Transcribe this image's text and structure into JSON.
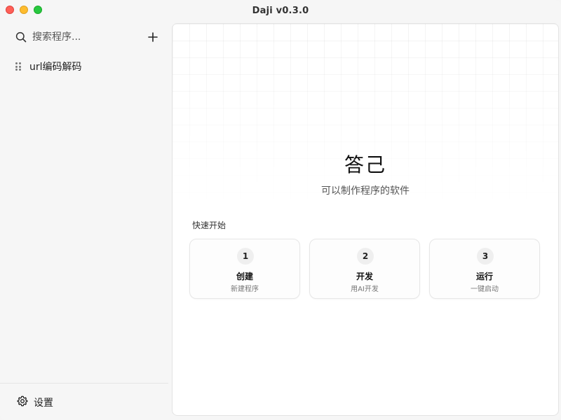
{
  "window": {
    "title": "Daji  v0.3.0"
  },
  "sidebar": {
    "search": {
      "placeholder": "搜索程序..."
    },
    "add_label": "+",
    "items": [
      {
        "label": "url编码解码"
      }
    ],
    "settings_label": "设置"
  },
  "main": {
    "hero_title": "答己",
    "hero_subtitle": "可以制作程序的软件",
    "quick_start_label": "快速开始",
    "cards": [
      {
        "number": "1",
        "title": "创建",
        "desc": "新建程序"
      },
      {
        "number": "2",
        "title": "开发",
        "desc": "用AI开发"
      },
      {
        "number": "3",
        "title": "运行",
        "desc": "一键启动"
      }
    ]
  },
  "icons": {
    "search": "search-icon",
    "add": "plus-icon",
    "drag": "drag-handle-icon",
    "settings": "gear-icon"
  },
  "colors": {
    "close": "#ff5f57",
    "minimize": "#febc2e",
    "maximize": "#28c840",
    "sidebar_bg": "#f6f6f6",
    "main_bg": "#ffffff"
  }
}
